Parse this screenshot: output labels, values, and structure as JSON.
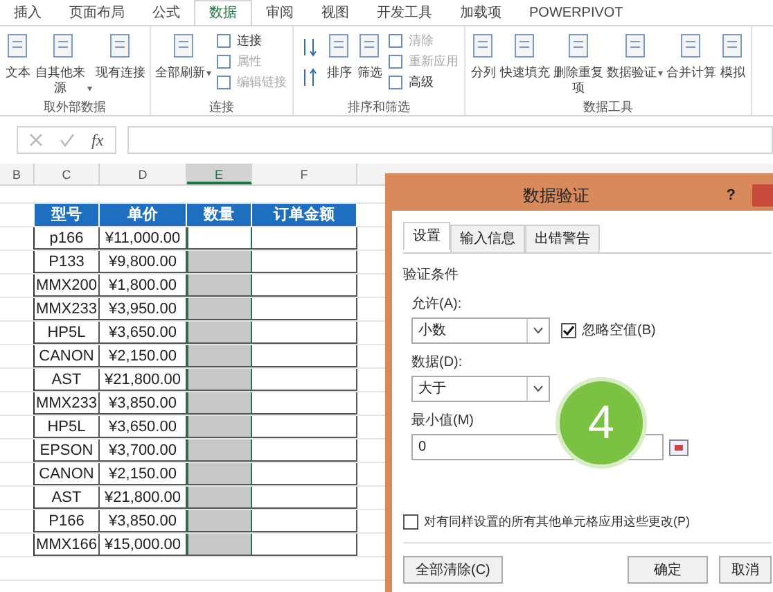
{
  "ribbon_tabs": [
    {
      "label": "插入",
      "selected": false
    },
    {
      "label": "页面布局",
      "selected": false
    },
    {
      "label": "公式",
      "selected": false
    },
    {
      "label": "数据",
      "selected": true
    },
    {
      "label": "审阅",
      "selected": false
    },
    {
      "label": "视图",
      "selected": false
    },
    {
      "label": "开发工具",
      "selected": false
    },
    {
      "label": "加载项",
      "selected": false
    },
    {
      "label": "POWERPIVOT",
      "selected": false
    }
  ],
  "ribbon_groups": [
    {
      "label": "取外部数据",
      "items": [
        {
          "kind": "big",
          "label": "文本"
        },
        {
          "kind": "big",
          "label": "自其他来源",
          "caret": "▾"
        },
        {
          "kind": "big",
          "label": "现有连接"
        }
      ]
    },
    {
      "label": "连接",
      "items": [
        {
          "kind": "big",
          "label": "全部刷新",
          "caret": "▾"
        },
        {
          "kind": "stack",
          "entries": [
            {
              "label": "连接",
              "disabled": false
            },
            {
              "label": "属性",
              "disabled": true
            },
            {
              "label": "编辑链接",
              "disabled": true
            }
          ]
        }
      ]
    },
    {
      "label": "排序和筛选",
      "items": [
        {
          "kind": "sortpair"
        },
        {
          "kind": "big",
          "label": "排序"
        },
        {
          "kind": "big",
          "label": "筛选"
        },
        {
          "kind": "stack",
          "entries": [
            {
              "label": "清除",
              "disabled": true
            },
            {
              "label": "重新应用",
              "disabled": true
            },
            {
              "label": "高级",
              "disabled": false
            }
          ]
        }
      ]
    },
    {
      "label": "数据工具",
      "items": [
        {
          "kind": "big",
          "label": "分列"
        },
        {
          "kind": "big",
          "label": "快速填充"
        },
        {
          "kind": "big",
          "label": "删除重复项"
        },
        {
          "kind": "big",
          "label": "数据验证",
          "caret": "▾"
        },
        {
          "kind": "big",
          "label": "合并计算"
        },
        {
          "kind": "big",
          "label": "模拟"
        }
      ]
    }
  ],
  "formula_bar": {
    "fx": "fx"
  },
  "columns": [
    {
      "label": "B",
      "selected": false
    },
    {
      "label": "C",
      "selected": false
    },
    {
      "label": "D",
      "selected": false
    },
    {
      "label": "E",
      "selected": true
    },
    {
      "label": "F",
      "selected": false
    }
  ],
  "table": {
    "headers": [
      "型号",
      "单价",
      "数量",
      "订单金额"
    ],
    "rows": [
      [
        "p166",
        "¥11,000.00"
      ],
      [
        "P133",
        "¥9,800.00"
      ],
      [
        "MMX200",
        "¥1,800.00"
      ],
      [
        "MMX233",
        "¥3,950.00"
      ],
      [
        "HP5L",
        "¥3,650.00"
      ],
      [
        "CANON",
        "¥2,150.00"
      ],
      [
        "AST",
        "¥21,800.00"
      ],
      [
        "MMX233",
        "¥3,850.00"
      ],
      [
        "HP5L",
        "¥3,650.00"
      ],
      [
        "EPSON",
        "¥3,700.00"
      ],
      [
        "CANON",
        "¥2,150.00"
      ],
      [
        "AST",
        "¥21,800.00"
      ],
      [
        "P166",
        "¥3,850.00"
      ],
      [
        "MMX166",
        "¥15,000.00"
      ]
    ]
  },
  "dialog": {
    "title": "数据验证",
    "help": "?",
    "tabs": [
      {
        "label": "设置",
        "selected": true
      },
      {
        "label": "输入信息",
        "selected": false
      },
      {
        "label": "出错警告",
        "selected": false
      }
    ],
    "section": "验证条件",
    "allow_label": "允许(A):",
    "allow_value": "小数",
    "ignore_blank": {
      "label": "忽略空值(B)",
      "checked": true
    },
    "data_label": "数据(D):",
    "data_value": "大于",
    "min_label": "最小值(M)",
    "min_value": "0",
    "apply_all": {
      "label": "对有同样设置的所有其他单元格应用这些更改(P)",
      "checked": false
    },
    "buttons": [
      "全部清除(C)",
      "确定",
      "取消"
    ]
  },
  "step_badge": "4"
}
